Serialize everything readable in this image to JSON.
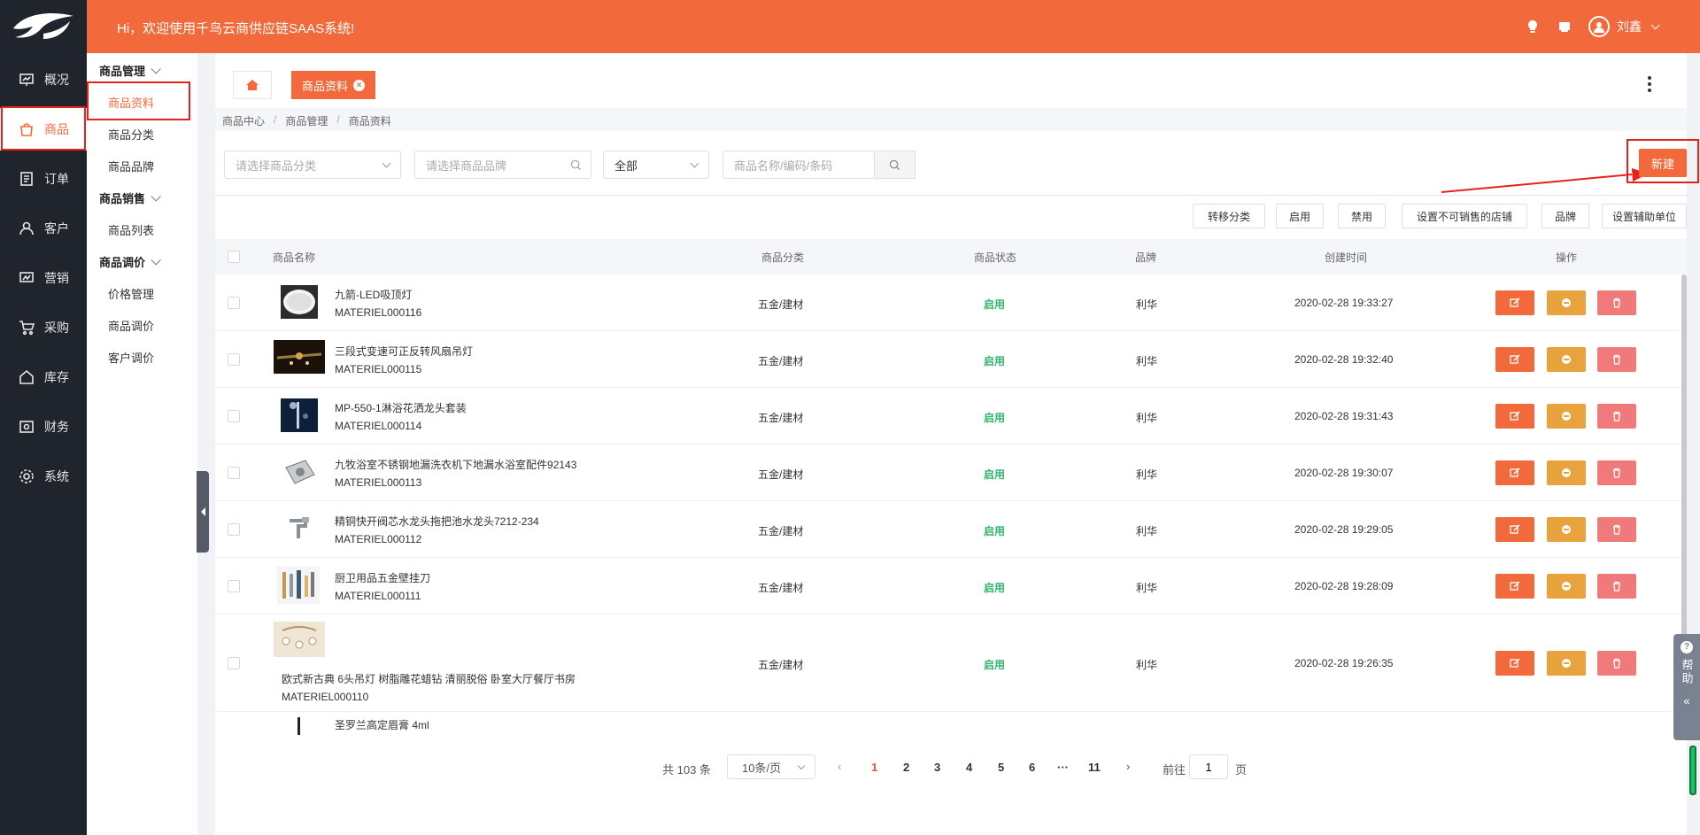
{
  "header": {
    "welcome": "Hi，欢迎使用千鸟云商供应链SAAS系统!",
    "user_name": "刘鑫"
  },
  "nav": {
    "items": [
      {
        "label": "概况",
        "icon": "chart-board-icon"
      },
      {
        "label": "商品",
        "icon": "shopping-bag-icon"
      },
      {
        "label": "订单",
        "icon": "order-list-icon"
      },
      {
        "label": "客户",
        "icon": "user-icon"
      },
      {
        "label": "营销",
        "icon": "marketing-icon"
      },
      {
        "label": "采购",
        "icon": "cart-icon"
      },
      {
        "label": "库存",
        "icon": "home-icon"
      },
      {
        "label": "财务",
        "icon": "wallet-icon"
      },
      {
        "label": "系统",
        "icon": "gear-icon"
      }
    ]
  },
  "subnav": {
    "groups": [
      {
        "label": "商品管理",
        "items": [
          "商品资料",
          "商品分类",
          "商品品牌"
        ]
      },
      {
        "label": "商品销售",
        "items": [
          "商品列表"
        ]
      },
      {
        "label": "商品调价",
        "items": [
          "价格管理",
          "商品调价",
          "客户调价"
        ]
      }
    ]
  },
  "tabs": {
    "current": "商品资料"
  },
  "breadcrumb": [
    "商品中心",
    "商品管理",
    "商品资料"
  ],
  "filters": {
    "category_placeholder": "请选择商品分类",
    "brand_placeholder": "请选择商品品牌",
    "status_value": "全部",
    "keyword_placeholder": "商品名称/编码/条码",
    "new_label": "新建"
  },
  "actions": [
    "转移分类",
    "启用",
    "禁用",
    "设置不可销售的店铺",
    "品牌",
    "设置辅助单位"
  ],
  "table": {
    "columns": [
      "商品名称",
      "商品分类",
      "商品状态",
      "品牌",
      "创建时间",
      "操作"
    ],
    "rows": [
      {
        "name": "九箭-LED吸顶灯",
        "code": "MATERIEL000116",
        "category": "五金/建材",
        "status": "启用",
        "brand": "利华",
        "created": "2020-02-28 19:33:27"
      },
      {
        "name": "三段式变速可正反转风扇吊灯",
        "code": "MATERIEL000115",
        "category": "五金/建材",
        "status": "启用",
        "brand": "利华",
        "created": "2020-02-28 19:32:40"
      },
      {
        "name": "MP-550-1淋浴花洒龙头套装",
        "code": "MATERIEL000114",
        "category": "五金/建材",
        "status": "启用",
        "brand": "利华",
        "created": "2020-02-28 19:31:43"
      },
      {
        "name": "九牧浴室不锈钢地漏洗衣机下地漏水浴室配件92143",
        "code": "MATERIEL000113",
        "category": "五金/建材",
        "status": "启用",
        "brand": "利华",
        "created": "2020-02-28 19:30:07"
      },
      {
        "name": "精铜快开阀芯水龙头拖把池水龙头7212-234",
        "code": "MATERIEL000112",
        "category": "五金/建材",
        "status": "启用",
        "brand": "利华",
        "created": "2020-02-28 19:29:05"
      },
      {
        "name": "厨卫用品五金壁挂刀",
        "code": "MATERIEL000111",
        "category": "五金/建材",
        "status": "启用",
        "brand": "利华",
        "created": "2020-02-28 19:28:09"
      },
      {
        "name": "欧式新古典 6头吊灯 树脂雕花蜡钻 清丽脱俗 卧室大厅餐厅书房",
        "code": "MATERIEL000110",
        "category": "五金/建材",
        "status": "启用",
        "brand": "利华",
        "created": "2020-02-28 19:26:35"
      },
      {
        "name": "圣罗兰高定眉膏 4ml",
        "code": "",
        "category": "",
        "status": "",
        "brand": "",
        "created": ""
      }
    ]
  },
  "pager": {
    "total": "共 103 条",
    "page_size": "10条/页",
    "pages": [
      "1",
      "2",
      "3",
      "4",
      "5",
      "6",
      "···",
      "11"
    ],
    "goto_prefix": "前往",
    "goto_value": "1",
    "goto_suffix": "页"
  },
  "help": {
    "label": "帮助"
  },
  "colors": {
    "brand": "#f26a3b",
    "sidebar": "#20242c",
    "status_on": "#2fb36b"
  }
}
